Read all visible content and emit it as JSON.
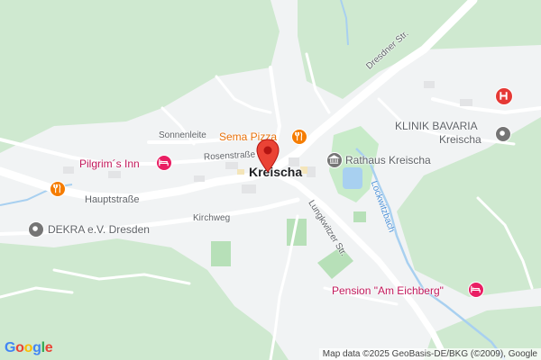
{
  "map": {
    "town": "Kreischa",
    "streets": {
      "dresdner": "Dresdner Str.",
      "sonnenleite": "Sonnenleite",
      "rosenstrasse": "Rosenstraße",
      "hauptstrasse": "Hauptstraße",
      "kirchweg": "Kirchweg",
      "lungkwitzer": "Lungkwitzer Str."
    },
    "water": {
      "lockwitzbach": "Lockwitzbach"
    },
    "pois": {
      "sema_pizza": "Sema Pizza",
      "pilgrims_inn": "Pilgrim´s Inn",
      "rathaus": "Rathaus Kreischa",
      "klinik_line1": "KLINIK BAVARIA",
      "klinik_line2": "Kreischa",
      "dekra": "DEKRA e.V. Dresden",
      "pension": "Pension \"Am Eichberg\""
    },
    "colors": {
      "forest": "#cfe9d0",
      "road": "#ffffff",
      "water": "#a8d0f0",
      "marker": "#ea4335",
      "restaurant": "#f57c00",
      "hotel": "#e91e63",
      "landmark": "#757575",
      "hospital": "#e53935"
    }
  },
  "attribution": "Map data ©2025 GeoBasis-DE/BKG (©2009), Google",
  "google_logo": {
    "letters": [
      "G",
      "o",
      "o",
      "g",
      "l",
      "e"
    ],
    "colors": [
      "#4285F4",
      "#EA4335",
      "#FBBC05",
      "#4285F4",
      "#34A853",
      "#EA4335"
    ]
  }
}
